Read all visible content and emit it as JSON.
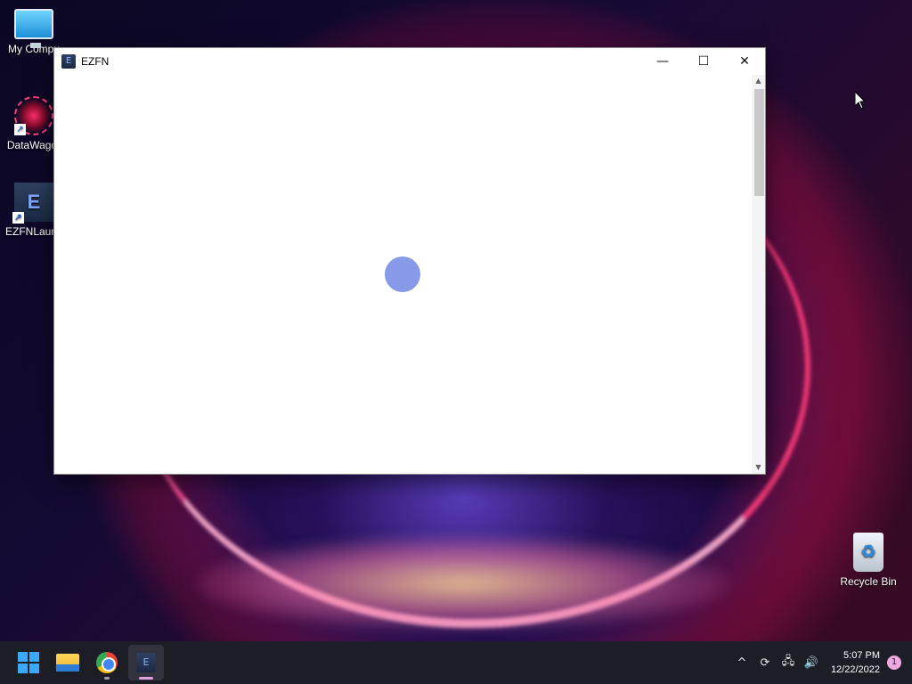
{
  "desktop": {
    "icons": [
      {
        "label": "My Compu",
        "icon": "computer-icon"
      },
      {
        "label": "DataWagor",
        "icon": "datawagon-icon"
      },
      {
        "label": "EZFNLaunc",
        "icon": "ezfn-launcher-icon"
      },
      {
        "label": "Recycle Bin",
        "icon": "recycle-bin-icon"
      }
    ]
  },
  "window": {
    "title": "EZFN",
    "controls": {
      "minimize": "—",
      "maximize": "☐",
      "close": "✕"
    },
    "loader_color": "#8899e8"
  },
  "taskbar": {
    "apps": [
      "start-icon",
      "file-explorer-icon",
      "chrome-icon",
      "ezfn-icon"
    ],
    "tray": {
      "chevron": "^",
      "clock_time": "5:07 PM",
      "clock_date": "12/22/2022",
      "notification_count": "1"
    }
  }
}
